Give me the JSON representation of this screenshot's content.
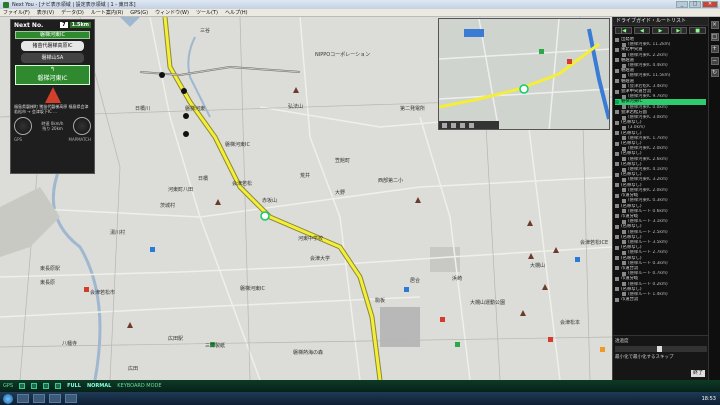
{
  "window": {
    "title": "Next You - [ナビ表示領域 | 設定表示領域 | 1 - 東日本]"
  },
  "menu": [
    "ファイル(F)",
    "表示(V)",
    "データ(D)",
    "ルート案内(R)",
    "GPS(G)",
    "ウィンドウ(W)",
    "ツール(T)",
    "ヘルプ(H)"
  ],
  "nav": {
    "next_label": "Next No.",
    "next_num": "7",
    "next_dist": "1.5km",
    "next_ic": "磐梯河東IC",
    "road1": "猪苗代磐梯高原IC",
    "road2": "磐梯山SA",
    "current": "磐梯河東IC",
    "address": "福島県磐梯町 猪苗代磐梯高原 福島県会津若松市 → 会津坂下IC ...",
    "speed1": "時速 0km/h",
    "speed2": "残り 20km",
    "rpm_label": "GPS",
    "rpm_label2": "MAPMATCH"
  },
  "map": {
    "labels": [
      "日橋川",
      "三谷",
      "NIPPOコーポレーション",
      "磐梯河東",
      "弘法山",
      "第二発電所",
      "磐梯河東IC",
      "笠館町",
      "日橋",
      "荒井",
      "茨城村",
      "西部第二小",
      "河東町八田",
      "会津若松",
      "赤坂山",
      "大野",
      "東長原駅",
      "広田駅",
      "三菱製紙",
      "磐梯熱海の森",
      "大槻山",
      "会津松本",
      "八幡寺",
      "河東中学校",
      "東長原",
      "会津若松市",
      "湯川村",
      "居合",
      "浜崎",
      "磐梯河東IC",
      "会津大学",
      "会津若松ICE",
      "駒板",
      "広田",
      "大槻山運動公園"
    ]
  },
  "sidebar": {
    "title": "ドライブガイド・ルートリスト",
    "controls": [
      "|◀",
      "◀",
      "▶",
      "▶|",
      "■"
    ],
    "items": [
      {
        "text": "出発地",
        "sub": false,
        "hl": false
      },
      {
        "text": "(磐梯河東IC 11.2km)",
        "sub": true,
        "hl": false
      },
      {
        "text": "東北中央道",
        "sub": false,
        "hl": false
      },
      {
        "text": "(磐梯河東IC 2.2km)",
        "sub": true,
        "hl": false
      },
      {
        "text": "磐越道",
        "sub": false,
        "hl": false
      },
      {
        "text": "(磐梯河東IC 4.4km)",
        "sub": true,
        "hl": false
      },
      {
        "text": "磐越道",
        "sub": false,
        "hl": false
      },
      {
        "text": "(磐梯河東IC 11.5km)",
        "sub": true,
        "hl": false
      },
      {
        "text": "磐越道",
        "sub": false,
        "hl": false
      },
      {
        "text": "(会津若松IC 3.4km)",
        "sub": true,
        "hl": false
      },
      {
        "text": "会津中央道合流",
        "sub": false,
        "hl": false
      },
      {
        "text": "(磐梯河東IC 9.7km)",
        "sub": true,
        "hl": false
      },
      {
        "text": "磐梯河東IC",
        "sub": false,
        "hl": true
      },
      {
        "text": "(磐梯河東IC 0.0km)",
        "sub": true,
        "hl": false
      },
      {
        "text": "会津若松方面",
        "sub": false,
        "hl": false
      },
      {
        "text": "(磐梯河東IC 3.0km)",
        "sub": true,
        "hl": false
      },
      {
        "text": "(名称なし)",
        "sub": false,
        "hl": false
      },
      {
        "text": "(3.0km)",
        "sub": true,
        "hl": false
      },
      {
        "text": "(名称なし)",
        "sub": false,
        "hl": false
      },
      {
        "text": "(磐梯河東IC 1.7km)",
        "sub": true,
        "hl": false
      },
      {
        "text": "(名称なし)",
        "sub": false,
        "hl": false
      },
      {
        "text": "(磐梯河東IC 2.0km)",
        "sub": true,
        "hl": false
      },
      {
        "text": "(名称なし)",
        "sub": false,
        "hl": false
      },
      {
        "text": "(磐梯河東IC 2.6km)",
        "sub": true,
        "hl": false
      },
      {
        "text": "(名称なし)",
        "sub": false,
        "hl": false
      },
      {
        "text": "(磐梯河東IC 4.1km)",
        "sub": true,
        "hl": false
      },
      {
        "text": "(名称なし)",
        "sub": false,
        "hl": false
      },
      {
        "text": "(磐梯河東IC 3.2km)",
        "sub": true,
        "hl": false
      },
      {
        "text": "(名称なし)",
        "sub": false,
        "hl": false
      },
      {
        "text": "(磐梯河東IC 2.0km)",
        "sub": true,
        "hl": false
      },
      {
        "text": "市道分岐",
        "sub": false,
        "hl": false
      },
      {
        "text": "(磐梯河東IC 0.3km)",
        "sub": true,
        "hl": false
      },
      {
        "text": "(名称なし)",
        "sub": false,
        "hl": false
      },
      {
        "text": "(磐梯ルート 0.6km)",
        "sub": true,
        "hl": false
      },
      {
        "text": "市道分岐",
        "sub": false,
        "hl": false
      },
      {
        "text": "(磐梯ルート 3.1km)",
        "sub": true,
        "hl": false
      },
      {
        "text": "(名称なし)",
        "sub": false,
        "hl": false
      },
      {
        "text": "(磐梯ルート 2.5km)",
        "sub": true,
        "hl": false
      },
      {
        "text": "(名称なし)",
        "sub": false,
        "hl": false
      },
      {
        "text": "(磐梯ルート 3.5km)",
        "sub": true,
        "hl": false
      },
      {
        "text": "(名称なし)",
        "sub": false,
        "hl": false
      },
      {
        "text": "(磐梯ルート 2.7km)",
        "sub": true,
        "hl": false
      },
      {
        "text": "(名称なし)",
        "sub": false,
        "hl": false
      },
      {
        "text": "(磐梯ルート 0.3km)",
        "sub": true,
        "hl": false
      },
      {
        "text": "市道合流",
        "sub": false,
        "hl": false
      },
      {
        "text": "(磐梯ルート 0.7km)",
        "sub": true,
        "hl": false
      },
      {
        "text": "市道分岐",
        "sub": false,
        "hl": false
      },
      {
        "text": "(磐梯ルート 0.2km)",
        "sub": true,
        "hl": false
      },
      {
        "text": "(名称なし)",
        "sub": false,
        "hl": false
      },
      {
        "text": "(磐梯ルート 1.4km)",
        "sub": true,
        "hl": false
      },
      {
        "text": "市道合流",
        "sub": false,
        "hl": false
      }
    ],
    "footer_label": "透過度",
    "footer_check": "最小化で最小化するスキップ",
    "close_label": "終了"
  },
  "status": {
    "gps": "GPS",
    "mode1": "FULL",
    "mode2": "NORMAL",
    "text": "KEYBOARD MODE"
  },
  "taskbar": {
    "clock": "18:53"
  }
}
